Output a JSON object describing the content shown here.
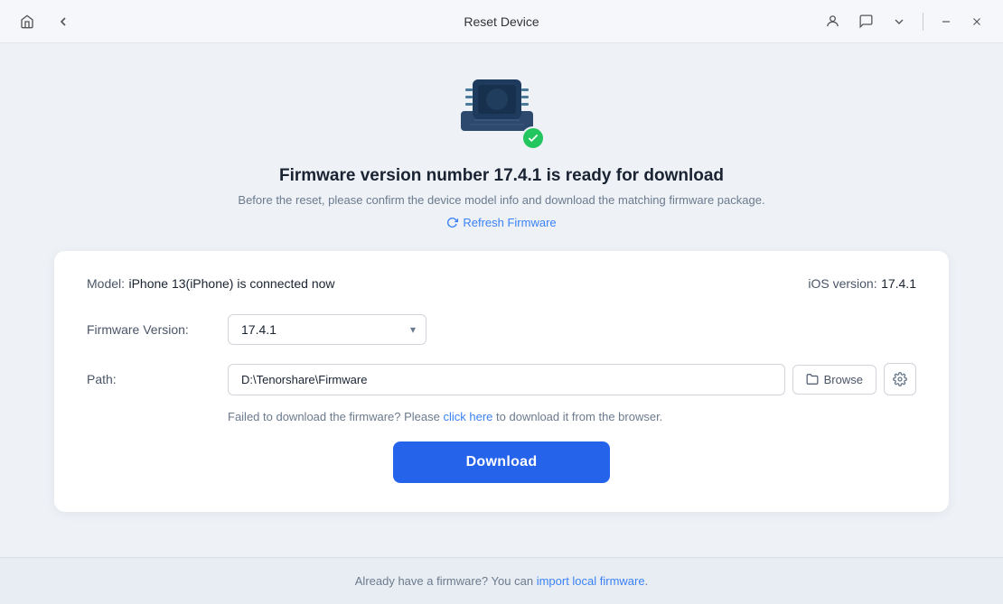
{
  "titlebar": {
    "title": "Reset Device",
    "back_icon": "←",
    "home_icon": "⌂",
    "user_icon": "👤",
    "chat_icon": "💬",
    "chevron_icon": "∨",
    "minimize_icon": "—",
    "close_icon": "✕"
  },
  "hero": {
    "title": "Firmware version number 17.4.1 is ready for download",
    "subtitle": "Before the reset, please confirm the device model info and download the matching firmware package.",
    "refresh_label": "Refresh Firmware"
  },
  "card": {
    "model_label": "Model:",
    "model_value": "iPhone 13(iPhone) is connected now",
    "ios_label": "iOS version:",
    "ios_value": "17.4.1",
    "firmware_label": "Firmware Version:",
    "firmware_value": "17.4.1",
    "path_label": "Path:",
    "path_value": "D:\\Tenorshare\\Firmware",
    "browse_label": "Browse",
    "error_hint_before": "Failed to download the firmware? Please",
    "error_link": "click here",
    "error_hint_after": "to download it from the browser.",
    "download_label": "Download"
  },
  "footer": {
    "text_before": "Already have a firmware? You can",
    "link_text": "import local firmware",
    "text_after": "."
  }
}
